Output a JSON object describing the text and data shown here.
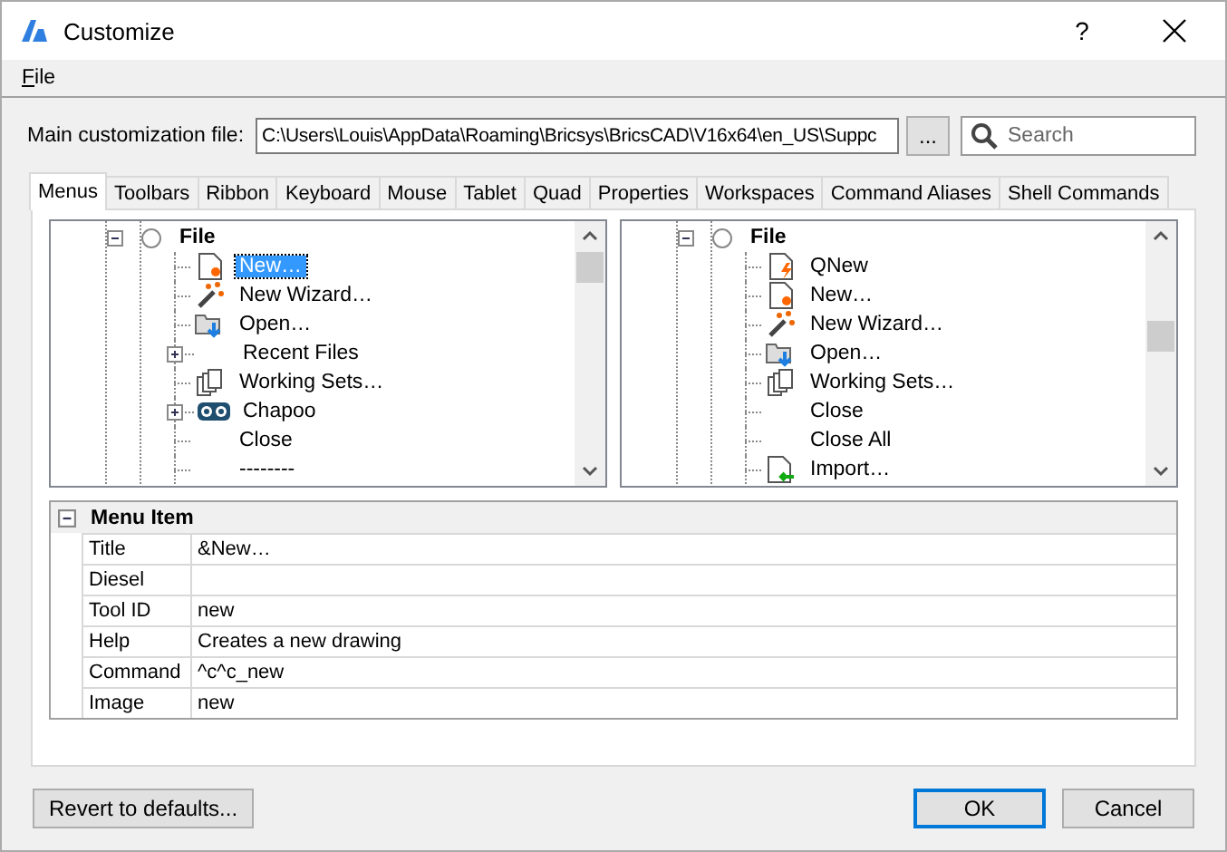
{
  "window": {
    "title": "Customize",
    "help": "?"
  },
  "menu": [
    {
      "label": "File"
    }
  ],
  "customization_file": {
    "label": "Main customization file:",
    "value": "C:\\Users\\Louis\\AppData\\Roaming\\Bricsys\\BricsCAD\\V16x64\\en_US\\Suppc",
    "browse": "..."
  },
  "search": {
    "placeholder": "Search"
  },
  "tabs": [
    {
      "label": "Menus",
      "selected": true
    },
    {
      "label": "Toolbars",
      "selected": false
    },
    {
      "label": "Ribbon",
      "selected": false
    },
    {
      "label": "Keyboard",
      "selected": false
    },
    {
      "label": "Mouse",
      "selected": false
    },
    {
      "label": "Tablet",
      "selected": false
    },
    {
      "label": "Quad",
      "selected": false
    },
    {
      "label": "Properties",
      "selected": false
    },
    {
      "label": "Workspaces",
      "selected": false
    },
    {
      "label": "Command Aliases",
      "selected": false
    },
    {
      "label": "Shell Commands",
      "selected": false
    }
  ],
  "trees": [
    {
      "label": "File",
      "expanded": true,
      "children": [
        {
          "label": "New…",
          "kind": "new",
          "collapsed": false,
          "selected": true
        },
        {
          "label": "New Wizard…",
          "kind": "wizard",
          "collapsed": false,
          "selected": false
        },
        {
          "label": "Open…",
          "kind": "open",
          "collapsed": false,
          "selected": false
        },
        {
          "label": "Recent Files",
          "kind": "none",
          "collapsed": true,
          "selected": false
        },
        {
          "label": "Working Sets…",
          "kind": "sets",
          "collapsed": false,
          "selected": false
        },
        {
          "label": "Chapoo",
          "kind": "chapoo",
          "collapsed": true,
          "selected": false
        },
        {
          "label": "Close",
          "kind": "none",
          "collapsed": false,
          "selected": false
        },
        {
          "label": "--------",
          "kind": "none",
          "collapsed": false,
          "selected": false
        }
      ]
    },
    {
      "label": "File",
      "expanded": true,
      "children": [
        {
          "label": "QNew",
          "kind": "qnew",
          "collapsed": false,
          "selected": false
        },
        {
          "label": "New…",
          "kind": "new",
          "collapsed": false,
          "selected": false
        },
        {
          "label": "New Wizard…",
          "kind": "wizard",
          "collapsed": false,
          "selected": false
        },
        {
          "label": "Open…",
          "kind": "open",
          "collapsed": false,
          "selected": false
        },
        {
          "label": "Working Sets…",
          "kind": "sets",
          "collapsed": false,
          "selected": false
        },
        {
          "label": "Close",
          "kind": "none",
          "collapsed": false,
          "selected": false
        },
        {
          "label": "Close All",
          "kind": "none",
          "collapsed": false,
          "selected": false
        },
        {
          "label": "Import…",
          "kind": "import",
          "collapsed": false,
          "selected": false
        }
      ]
    }
  ],
  "properties": {
    "title": "Menu Item",
    "expanded": true,
    "rows": [
      {
        "name": "Title",
        "value": "&New…"
      },
      {
        "name": "Diesel",
        "value": ""
      },
      {
        "name": "Tool ID",
        "value": "new"
      },
      {
        "name": "Help",
        "value": "Creates a new drawing"
      },
      {
        "name": "Command",
        "value": "^c^c_new"
      },
      {
        "name": "Image",
        "value": "new"
      }
    ]
  },
  "buttons": {
    "revert": "Revert to defaults...",
    "ok": "OK",
    "cancel": "Cancel"
  }
}
